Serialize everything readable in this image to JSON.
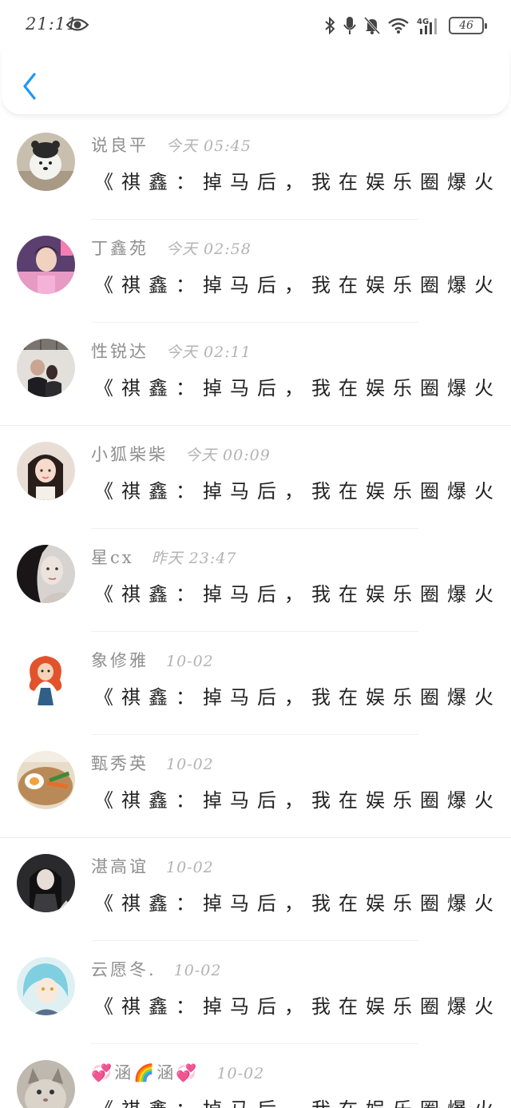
{
  "status_bar": {
    "time": "21:11",
    "network": "4G",
    "battery": "46",
    "icons": [
      "eye-icon",
      "bluetooth-icon",
      "mic-icon",
      "bell-off-icon",
      "wifi-icon",
      "signal-icon",
      "battery-icon"
    ]
  },
  "header": {
    "back_icon": "chevron-left-icon",
    "accent_color": "#2196f3"
  },
  "items": [
    {
      "name": "说良平",
      "time": "今天 05:45",
      "message": "《祺鑫：掉马后，我在娱乐圈爆火···"
    },
    {
      "name": "丁鑫苑",
      "time": "今天 02:58",
      "message": "《祺鑫：掉马后，我在娱乐圈爆火···"
    },
    {
      "name": "性锐达",
      "time": "今天 02:11",
      "message": "《祺鑫：掉马后，我在娱乐圈爆火···"
    },
    {
      "name": "小狐柴柴",
      "time": "今天 00:09",
      "message": "《祺鑫：掉马后，我在娱乐圈爆火···"
    },
    {
      "name": "星cx",
      "time": "昨天 23:47",
      "message": "《祺鑫：掉马后，我在娱乐圈爆火···"
    },
    {
      "name": "象修雅",
      "time": "10-02",
      "message": "《祺鑫：掉马后，我在娱乐圈爆火···"
    },
    {
      "name": "甄秀英",
      "time": "10-02",
      "message": "《祺鑫：掉马后，我在娱乐圈爆火···"
    },
    {
      "name": "湛高谊",
      "time": "10-02",
      "message": "《祺鑫：掉马后，我在娱乐圈爆火···"
    },
    {
      "name": "云愿冬.",
      "time": "10-02",
      "message": "《祺鑫：掉马后，我在娱乐圈爆火···"
    },
    {
      "name": "💞涵🌈涵💞",
      "time": "10-02",
      "message": "《祺鑫：掉马后，我在娱乐圈爆火···"
    }
  ]
}
